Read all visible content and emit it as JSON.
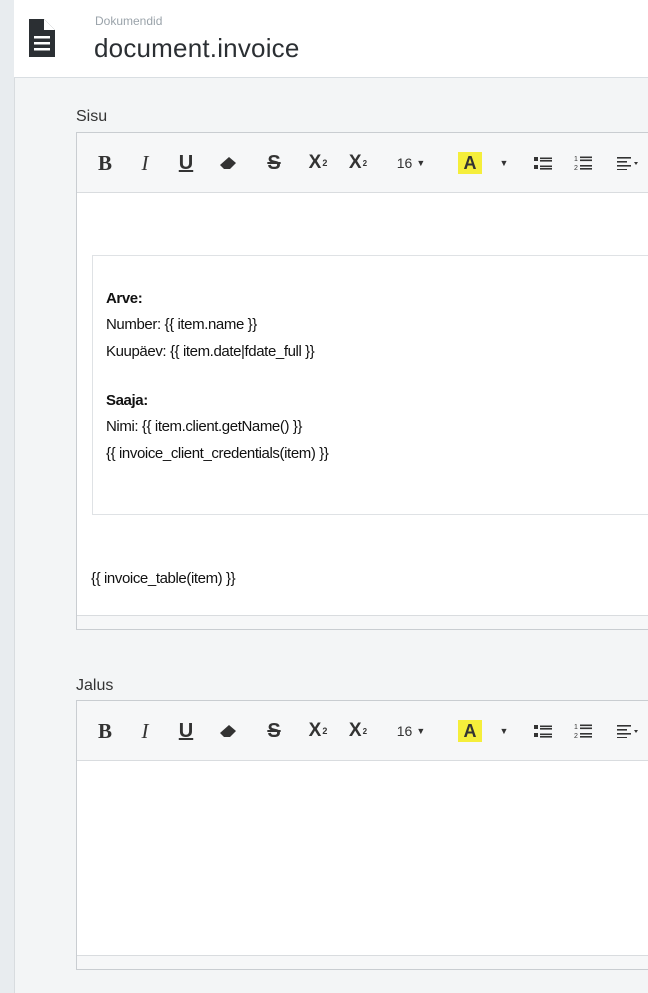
{
  "header": {
    "breadcrumb": "Dokumendid",
    "title": "document.invoice",
    "icon": "document-icon"
  },
  "toolbar": {
    "bold": "B",
    "italic": "I",
    "underline": "U",
    "strikethrough": "S",
    "superscript": "X",
    "subscript": "X",
    "font_size": "16",
    "highlight": "A",
    "highlight_color": "#f5ee3b"
  },
  "sisu": {
    "label": "Sisu",
    "lines": {
      "arve_heading": "Arve:",
      "number": "Number: {{ item.name }}",
      "kuupaev": "Kuupäev: {{ item.date|fdate_full }}",
      "saaja_heading": "Saaja:",
      "nimi": "Nimi: {{ item.client.getName() }}",
      "credentials": "{{ invoice_client_credentials(item) }}",
      "table": "{{ invoice_table(item) }}"
    }
  },
  "jalus": {
    "label": "Jalus"
  }
}
